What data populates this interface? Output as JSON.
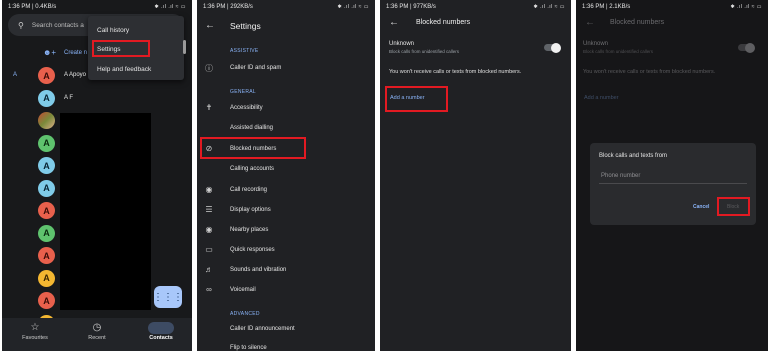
{
  "colors": {
    "highlight": "#e21a22",
    "accent": "#8ab4f8",
    "fab": "#a8c7fa"
  },
  "panel1": {
    "status_time": "1:36 PM | 0.4KB/s",
    "status_icons": "✱ .ıl .ıl ≈ ▭",
    "search_placeholder": "Search contacts a",
    "create_label": "Create n",
    "menu": {
      "call_history": "Call history",
      "settings": "Settings",
      "help": "Help and feedback"
    },
    "section_letter": "A",
    "contacts": [
      {
        "initial": "A",
        "name": "A Apoyo",
        "color": "red"
      },
      {
        "initial": "A",
        "name": "A F",
        "color": "blue"
      },
      {
        "initial": "",
        "name": "",
        "color": "photo"
      },
      {
        "initial": "A",
        "name": "",
        "color": "green"
      },
      {
        "initial": "A",
        "name": "",
        "color": "blue"
      },
      {
        "initial": "A",
        "name": "",
        "color": "blue"
      },
      {
        "initial": "A",
        "name": "",
        "color": "red"
      },
      {
        "initial": "A",
        "name": "",
        "color": "green"
      },
      {
        "initial": "A",
        "name": "",
        "color": "red"
      },
      {
        "initial": "A",
        "name": "",
        "color": "yellow"
      },
      {
        "initial": "A",
        "name": "",
        "color": "red"
      },
      {
        "initial": "A",
        "name": "",
        "color": "yellow"
      }
    ],
    "nav": {
      "favourites": "Favourites",
      "recent": "Recent",
      "contacts": "Contacts"
    }
  },
  "panel2": {
    "status_time": "1:36 PM | 292KB/s",
    "status_icons": "✱ .ıl .ıl ≈ ▭",
    "title": "Settings",
    "section_assistive": "ASSISTIVE",
    "section_general": "GENERAL",
    "section_advanced": "ADVANCED",
    "items": {
      "caller_id_spam": "Caller ID and spam",
      "accessibility": "Accessibility",
      "assisted_dialling": "Assisted dialling",
      "blocked_numbers": "Blocked numbers",
      "calling_accounts": "Calling accounts",
      "call_recording": "Call recording",
      "display_options": "Display options",
      "nearby_places": "Nearby places",
      "quick_responses": "Quick responses",
      "sounds_vibration": "Sounds and vibration",
      "voicemail": "Voicemail",
      "caller_id_announcement": "Caller ID announcement",
      "flip_to_silence": "Flip to silence"
    }
  },
  "panel3": {
    "status_time": "1:36 PM | 977KB/s",
    "status_icons": "✱ .ıl .ıl ≈ ▭",
    "title": "Blocked numbers",
    "unknown_title": "Unknown",
    "unknown_sub": "Block calls from unidentified callers",
    "info": "You won't receive calls or texts from blocked numbers.",
    "add_number": "Add a number"
  },
  "panel4": {
    "status_time": "1:36 PM | 2.1KB/s",
    "status_icons": "✱ .ıl .ıl ≈ ▭",
    "title": "Blocked numbers",
    "unknown_title": "Unknown",
    "unknown_sub": "Block calls from unidentified callers",
    "info": "You won't receive calls or texts from blocked numbers.",
    "add_number": "Add a number",
    "dialog_title": "Block calls and texts from",
    "phone_placeholder": "Phone number",
    "cancel": "Cancel",
    "block": "Block"
  }
}
